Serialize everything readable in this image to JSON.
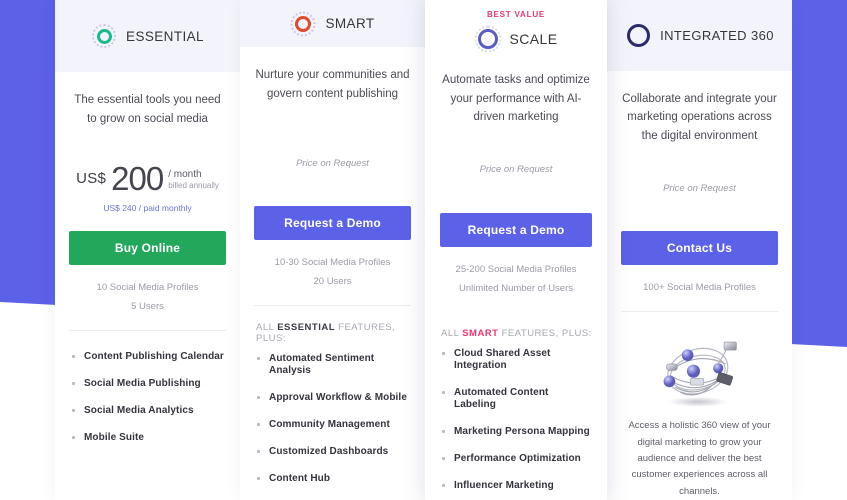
{
  "theme": {
    "purple": "#5c62e8",
    "green": "#22a75b",
    "pink": "#e8376f",
    "teal": "#1cb98f",
    "orange": "#e0492c",
    "navy": "#2c2a6e"
  },
  "plans": [
    {
      "id": "essential",
      "badge": "",
      "name": "ESSENTIAL",
      "icon": "ring-icon-essential",
      "tagline": "The essential tools you need to grow on social media",
      "price": {
        "currency": "US$",
        "amount": "200",
        "period": "/ month",
        "billing": "billed annually",
        "alt": "US$ 240 / paid monthly",
        "on_request": ""
      },
      "cta": "Buy Online",
      "meta": [
        "10 Social Media Profiles",
        "5 Users"
      ],
      "features_head": {
        "pre": "",
        "highlight": "",
        "post": ""
      },
      "features": [
        "Content Publishing Calendar",
        "Social Media Publishing",
        "Social Media Analytics",
        "Mobile Suite"
      ]
    },
    {
      "id": "smart",
      "badge": "",
      "name": "SMART",
      "icon": "ring-icon-smart",
      "tagline": "Nurture your communities and govern content publishing",
      "price": {
        "currency": "",
        "amount": "",
        "period": "",
        "billing": "",
        "alt": "",
        "on_request": "Price on Request"
      },
      "cta": "Request a Demo",
      "meta": [
        "10-30 Social Media Profiles",
        "20 Users"
      ],
      "features_head": {
        "pre": "ALL ",
        "highlight": "ESSENTIAL",
        "post": " FEATURES, PLUS:"
      },
      "features": [
        "Automated Sentiment Analysis",
        "Approval Workflow & Mobile",
        "Community Management",
        "Customized Dashboards",
        "Content Hub"
      ]
    },
    {
      "id": "scale",
      "badge": "BEST VALUE",
      "name": "SCALE",
      "icon": "ring-icon-scale",
      "tagline": "Automate tasks and optimize your performance with AI-driven marketing",
      "price": {
        "currency": "",
        "amount": "",
        "period": "",
        "billing": "",
        "alt": "",
        "on_request": "Price on Request"
      },
      "cta": "Request a Demo",
      "meta": [
        "25-200 Social Media Profiles",
        "Unlimited Number of Users"
      ],
      "features_head": {
        "pre": "ALL ",
        "highlight": "SMART",
        "post": " FEATURES, PLUS:"
      },
      "features": [
        "Cloud Shared Asset Integration",
        "Automated Content Labeling",
        "Marketing Persona Mapping",
        "Performance Optimization",
        "Influencer Marketing"
      ]
    },
    {
      "id": "integrated360",
      "badge": "",
      "name": "INTEGRATED 360",
      "icon": "ring-icon-integrated",
      "tagline": "Collaborate and integrate your marketing operations across the digital environment",
      "price": {
        "currency": "",
        "amount": "",
        "period": "",
        "billing": "",
        "alt": "",
        "on_request": "Price on Request"
      },
      "cta": "Contact Us",
      "meta": [
        "100+ Social Media Profiles"
      ],
      "features_head": {
        "pre": "",
        "highlight": "",
        "post": ""
      },
      "features": [],
      "illustration_caption": "Access a holistic 360 view of your digital marketing to grow your audience and deliver the best customer experiences across all channels."
    }
  ]
}
